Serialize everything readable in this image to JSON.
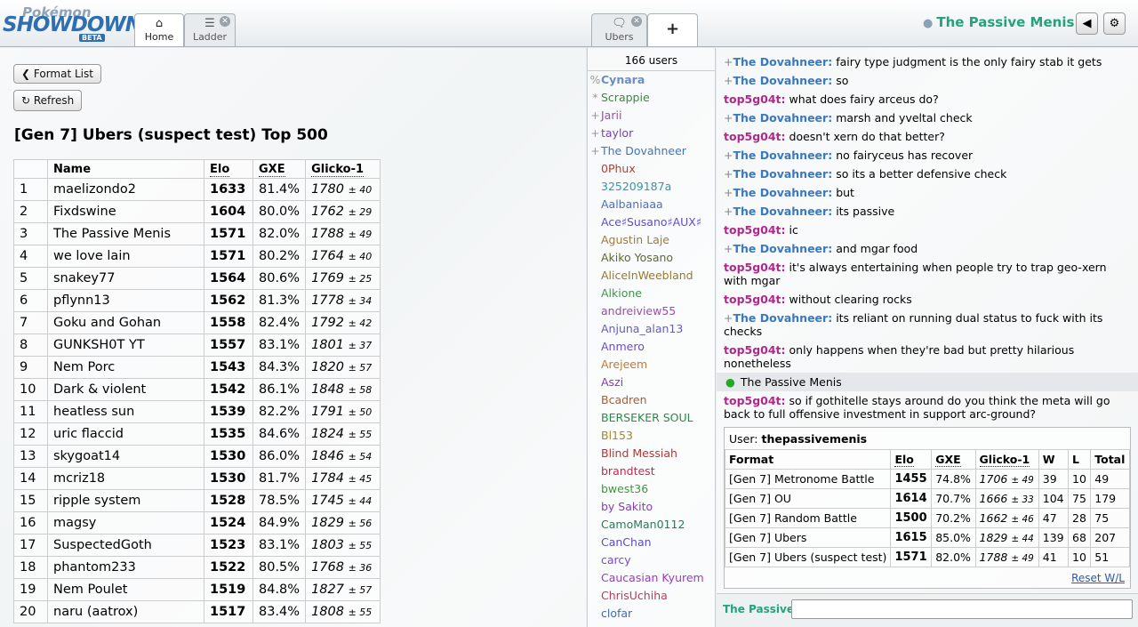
{
  "header": {
    "logo_top": "Pokémon",
    "logo_main": "SHOWDOWN!",
    "logo_badge": "BETA",
    "tabs": [
      {
        "label": "Home",
        "icon": "home-icon"
      },
      {
        "label": "Ladder",
        "icon": "list-icon"
      },
      {
        "label": "Ubers",
        "icon": "chat-bubble-icon"
      },
      {
        "label": "+",
        "icon": "plus-icon"
      }
    ],
    "username": "The Passive Menis",
    "volume_icon": "speaker-icon",
    "settings_icon": "gear-icon"
  },
  "left": {
    "format_list": "Format List",
    "refresh": "Refresh",
    "title": "[Gen 7] Ubers (suspect test) Top 500",
    "columns": [
      "",
      "Name",
      "Elo",
      "GXE",
      "Glicko-1"
    ],
    "rows": [
      {
        "rank": "1",
        "name": "maelizondo2",
        "elo": "1633",
        "gxe": "81.4%",
        "rating": "1780",
        "dev": "± 40"
      },
      {
        "rank": "2",
        "name": "Fixdswine",
        "elo": "1604",
        "gxe": "80.0%",
        "rating": "1762",
        "dev": "± 29"
      },
      {
        "rank": "3",
        "name": "The Passive Menis",
        "elo": "1571",
        "gxe": "82.0%",
        "rating": "1788",
        "dev": "± 49"
      },
      {
        "rank": "4",
        "name": "we love lain",
        "elo": "1571",
        "gxe": "80.2%",
        "rating": "1764",
        "dev": "± 40"
      },
      {
        "rank": "5",
        "name": "snakey77",
        "elo": "1564",
        "gxe": "80.6%",
        "rating": "1769",
        "dev": "± 25"
      },
      {
        "rank": "6",
        "name": "pflynn13",
        "elo": "1562",
        "gxe": "81.3%",
        "rating": "1778",
        "dev": "± 34"
      },
      {
        "rank": "7",
        "name": "Goku and Gohan",
        "elo": "1558",
        "gxe": "82.4%",
        "rating": "1792",
        "dev": "± 42"
      },
      {
        "rank": "8",
        "name": "GUNKSH0T YT",
        "elo": "1557",
        "gxe": "83.1%",
        "rating": "1801",
        "dev": "± 37"
      },
      {
        "rank": "9",
        "name": "Nem Porc",
        "elo": "1543",
        "gxe": "84.3%",
        "rating": "1820",
        "dev": "± 57"
      },
      {
        "rank": "10",
        "name": "Dark & violent",
        "elo": "1542",
        "gxe": "86.1%",
        "rating": "1848",
        "dev": "± 58"
      },
      {
        "rank": "11",
        "name": "heatless sun",
        "elo": "1539",
        "gxe": "82.2%",
        "rating": "1791",
        "dev": "± 50"
      },
      {
        "rank": "12",
        "name": "uric flaccid",
        "elo": "1535",
        "gxe": "84.6%",
        "rating": "1824",
        "dev": "± 55"
      },
      {
        "rank": "13",
        "name": "skygoat14",
        "elo": "1530",
        "gxe": "86.0%",
        "rating": "1846",
        "dev": "± 54"
      },
      {
        "rank": "14",
        "name": "mcriz18",
        "elo": "1530",
        "gxe": "81.7%",
        "rating": "1784",
        "dev": "± 45"
      },
      {
        "rank": "15",
        "name": "ripple system",
        "elo": "1528",
        "gxe": "78.5%",
        "rating": "1745",
        "dev": "± 44"
      },
      {
        "rank": "16",
        "name": "magsy",
        "elo": "1524",
        "gxe": "84.9%",
        "rating": "1829",
        "dev": "± 56"
      },
      {
        "rank": "17",
        "name": "SuspectedGoth",
        "elo": "1523",
        "gxe": "83.1%",
        "rating": "1803",
        "dev": "± 55"
      },
      {
        "rank": "18",
        "name": "phantom233",
        "elo": "1522",
        "gxe": "80.5%",
        "rating": "1768",
        "dev": "± 36"
      },
      {
        "rank": "19",
        "name": "Nem Poulet",
        "elo": "1519",
        "gxe": "84.8%",
        "rating": "1827",
        "dev": "± 57"
      },
      {
        "rank": "20",
        "name": "naru (aatrox)",
        "elo": "1517",
        "gxe": "83.4%",
        "rating": "1808",
        "dev": "± 55"
      }
    ]
  },
  "userlist": {
    "count": "166 users",
    "users": [
      {
        "g": "%",
        "name": "Cynara",
        "color": "#6b8dc7",
        "bold": true
      },
      {
        "g": "*",
        "name": "Scrappie",
        "color": "#3b8a3b",
        "bold": false
      },
      {
        "g": "+",
        "name": "Jarii",
        "color": "#9a4bb0",
        "bold": false
      },
      {
        "g": "+",
        "name": "taylor",
        "color": "#7a3fb5",
        "bold": false
      },
      {
        "g": "+",
        "name": "The Dovahneer",
        "color": "#3a78c0",
        "bold": false
      },
      {
        "g": "",
        "name": "0Phux",
        "color": "#c0392b",
        "bold": false
      },
      {
        "g": "",
        "name": "325209187a",
        "color": "#2a9ab0",
        "bold": false
      },
      {
        "g": "",
        "name": "Aalbaniaaa",
        "color": "#4a6fc0",
        "bold": false
      },
      {
        "g": "",
        "name": "Ace♯Susano♯AUX♯",
        "color": "#5a4fd0",
        "bold": false
      },
      {
        "g": "",
        "name": "Agustin Laje",
        "color": "#a07a3a",
        "bold": false
      },
      {
        "g": "",
        "name": "Akiko Yosano",
        "color": "#5a6a2a",
        "bold": false
      },
      {
        "g": "",
        "name": "AliceInWeebland",
        "color": "#9a7a2a",
        "bold": false
      },
      {
        "g": "",
        "name": "Alkione",
        "color": "#3a9a4a",
        "bold": false
      },
      {
        "g": "",
        "name": "andreiview55",
        "color": "#9a4ab0",
        "bold": false
      },
      {
        "g": "",
        "name": "Anjuna_alan13",
        "color": "#6a5ac0",
        "bold": false
      },
      {
        "g": "",
        "name": "Anmero",
        "color": "#6a4ad0",
        "bold": false
      },
      {
        "g": "",
        "name": "Arejeem",
        "color": "#c07a3a",
        "bold": false
      },
      {
        "g": "",
        "name": "Aszi",
        "color": "#8a3ab0",
        "bold": false
      },
      {
        "g": "",
        "name": "Bcadren",
        "color": "#b05a2a",
        "bold": false
      },
      {
        "g": "",
        "name": "BERSEKER SOUL",
        "color": "#2a8a4a",
        "bold": false
      },
      {
        "g": "",
        "name": "Bl153",
        "color": "#a08a2a",
        "bold": false
      },
      {
        "g": "",
        "name": "Blind Messiah",
        "color": "#c03030",
        "bold": false
      },
      {
        "g": "",
        "name": "brandtest",
        "color": "#c02a50",
        "bold": false
      },
      {
        "g": "",
        "name": "bwest36",
        "color": "#3a9a3a",
        "bold": false
      },
      {
        "g": "",
        "name": "by Sakito",
        "color": "#8a3ac0",
        "bold": false
      },
      {
        "g": "",
        "name": "CamoMan0112",
        "color": "#2a7a5a",
        "bold": false
      },
      {
        "g": "",
        "name": "CanChan",
        "color": "#5a4ad0",
        "bold": false
      },
      {
        "g": "",
        "name": "carcy",
        "color": "#7a4ad0",
        "bold": false
      },
      {
        "g": "",
        "name": "Caucasian Kyurem",
        "color": "#9a3ac0",
        "bold": false
      },
      {
        "g": "",
        "name": "ChrisUchiha",
        "color": "#c03a5a",
        "bold": false
      },
      {
        "g": "",
        "name": "clofar",
        "color": "#3a6ac0",
        "bold": false
      }
    ]
  },
  "chat": {
    "messages": [
      {
        "g": "+",
        "name": "The Dovahneer:",
        "color": "#3a78c0",
        "text": "fairy type judgment is the only fairy stab it gets"
      },
      {
        "g": "+",
        "name": "The Dovahneer:",
        "color": "#3a78c0",
        "text": "so"
      },
      {
        "g": "",
        "name": "top5g04t:",
        "color": "#b0288a",
        "text": "what does fairy arceus do?"
      },
      {
        "g": "+",
        "name": "The Dovahneer:",
        "color": "#3a78c0",
        "text": "marsh and yveltal check"
      },
      {
        "g": "",
        "name": "top5g04t:",
        "color": "#b0288a",
        "text": "doesn't xern do that better?"
      },
      {
        "g": "+",
        "name": "The Dovahneer:",
        "color": "#3a78c0",
        "text": "no fairyceus has recover"
      },
      {
        "g": "+",
        "name": "The Dovahneer:",
        "color": "#3a78c0",
        "text": "so its a better defensive check"
      },
      {
        "g": "+",
        "name": "The Dovahneer:",
        "color": "#3a78c0",
        "text": "but"
      },
      {
        "g": "+",
        "name": "The Dovahneer:",
        "color": "#3a78c0",
        "text": "its passive"
      },
      {
        "g": "",
        "name": "top5g04t:",
        "color": "#b0288a",
        "text": "ic"
      },
      {
        "g": "+",
        "name": "The Dovahneer:",
        "color": "#3a78c0",
        "text": "and mgar food"
      },
      {
        "g": "",
        "name": "top5g04t:",
        "color": "#b0288a",
        "text": "it's always entertaining when people try to trap geo-xern with mgar"
      },
      {
        "g": "",
        "name": "top5g04t:",
        "color": "#b0288a",
        "text": "without clearing rocks"
      },
      {
        "g": "+",
        "name": "The Dovahneer:",
        "color": "#3a78c0",
        "text": "its reliant on running dual status to fuck with its checks"
      },
      {
        "g": "",
        "name": "top5g04t:",
        "color": "#b0288a",
        "text": "only happens when they're bad but pretty hilarious nonetheless"
      }
    ],
    "notice": "The Passive Menis",
    "last_message": {
      "name": "top5g04t:",
      "color": "#b0288a",
      "text": "so if gothitelle stays around do you think the meta will go back to full offensive investment in support arc-ground?"
    },
    "userbox": {
      "label": "User:",
      "user": "thepassivemenis",
      "columns": [
        "Format",
        "Elo",
        "GXE",
        "Glicko-1",
        "W",
        "L",
        "Total"
      ],
      "rows": [
        {
          "format": "[Gen 7] Metronome Battle",
          "elo": "1455",
          "gxe": "74.8%",
          "rating": "1706",
          "dev": "± 49",
          "w": "39",
          "l": "10",
          "total": "49"
        },
        {
          "format": "[Gen 7] OU",
          "elo": "1614",
          "gxe": "70.7%",
          "rating": "1666",
          "dev": "± 33",
          "w": "104",
          "l": "75",
          "total": "179"
        },
        {
          "format": "[Gen 7] Random Battle",
          "elo": "1500",
          "gxe": "70.2%",
          "rating": "1662",
          "dev": "± 46",
          "w": "47",
          "l": "28",
          "total": "75"
        },
        {
          "format": "[Gen 7] Ubers",
          "elo": "1615",
          "gxe": "85.0%",
          "rating": "1829",
          "dev": "± 44",
          "w": "139",
          "l": "68",
          "total": "207"
        },
        {
          "format": "[Gen 7] Ubers (suspect test)",
          "elo": "1571",
          "gxe": "82.0%",
          "rating": "1788",
          "dev": "± 49",
          "w": "41",
          "l": "10",
          "total": "51"
        }
      ],
      "reset": "Reset W/L"
    },
    "input_name": "The Passive",
    "input_value": ""
  }
}
